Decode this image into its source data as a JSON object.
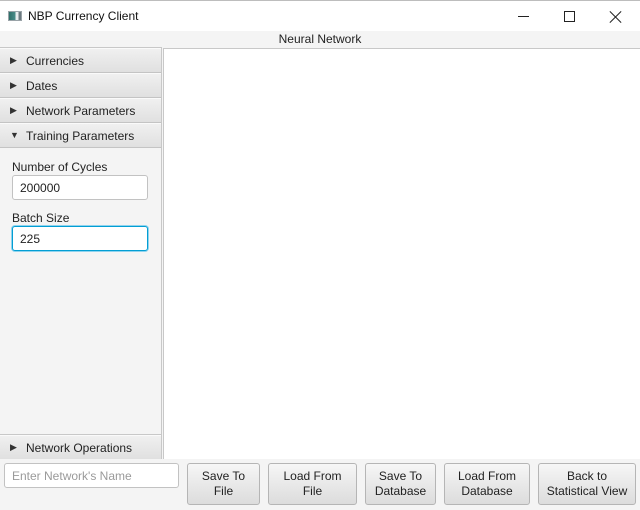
{
  "window": {
    "title": "NBP Currency Client",
    "icon": "app-window-icon",
    "controls": {
      "minimize": "minimize-icon",
      "maximize": "maximize-icon",
      "close": "close-icon"
    }
  },
  "header": {
    "title": "Neural Network"
  },
  "sidebar": {
    "panes": [
      {
        "label": "Currencies",
        "expanded": false,
        "arrow": "▶"
      },
      {
        "label": "Dates",
        "expanded": false,
        "arrow": "▶"
      },
      {
        "label": "Network Parameters",
        "expanded": false,
        "arrow": "▶"
      },
      {
        "label": "Training Parameters",
        "expanded": true,
        "arrow": "▼"
      },
      {
        "label": "Network Operations",
        "expanded": false,
        "arrow": "▶"
      }
    ],
    "training": {
      "cycles_label": "Number of Cycles",
      "cycles_value": "200000",
      "batch_label": "Batch Size",
      "batch_value": "225"
    }
  },
  "bottom": {
    "name_input": {
      "value": "",
      "placeholder": "Enter Network's Name"
    },
    "buttons": [
      {
        "label": "Save To\nFile"
      },
      {
        "label": "Load From File"
      },
      {
        "label": "Save To\nDatabase"
      },
      {
        "label": "Load From\nDatabase"
      },
      {
        "label": "Back to\nStatistical View"
      }
    ]
  }
}
